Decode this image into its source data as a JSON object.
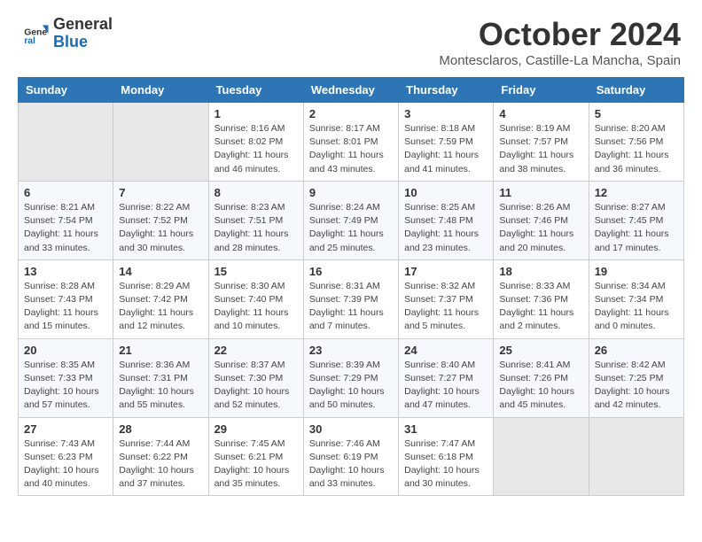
{
  "header": {
    "logo_general": "General",
    "logo_blue": "Blue",
    "month": "October 2024",
    "location": "Montesclaros, Castille-La Mancha, Spain"
  },
  "weekdays": [
    "Sunday",
    "Monday",
    "Tuesday",
    "Wednesday",
    "Thursday",
    "Friday",
    "Saturday"
  ],
  "weeks": [
    [
      {
        "day": "",
        "info": ""
      },
      {
        "day": "",
        "info": ""
      },
      {
        "day": "1",
        "info": "Sunrise: 8:16 AM\nSunset: 8:02 PM\nDaylight: 11 hours and 46 minutes."
      },
      {
        "day": "2",
        "info": "Sunrise: 8:17 AM\nSunset: 8:01 PM\nDaylight: 11 hours and 43 minutes."
      },
      {
        "day": "3",
        "info": "Sunrise: 8:18 AM\nSunset: 7:59 PM\nDaylight: 11 hours and 41 minutes."
      },
      {
        "day": "4",
        "info": "Sunrise: 8:19 AM\nSunset: 7:57 PM\nDaylight: 11 hours and 38 minutes."
      },
      {
        "day": "5",
        "info": "Sunrise: 8:20 AM\nSunset: 7:56 PM\nDaylight: 11 hours and 36 minutes."
      }
    ],
    [
      {
        "day": "6",
        "info": "Sunrise: 8:21 AM\nSunset: 7:54 PM\nDaylight: 11 hours and 33 minutes."
      },
      {
        "day": "7",
        "info": "Sunrise: 8:22 AM\nSunset: 7:52 PM\nDaylight: 11 hours and 30 minutes."
      },
      {
        "day": "8",
        "info": "Sunrise: 8:23 AM\nSunset: 7:51 PM\nDaylight: 11 hours and 28 minutes."
      },
      {
        "day": "9",
        "info": "Sunrise: 8:24 AM\nSunset: 7:49 PM\nDaylight: 11 hours and 25 minutes."
      },
      {
        "day": "10",
        "info": "Sunrise: 8:25 AM\nSunset: 7:48 PM\nDaylight: 11 hours and 23 minutes."
      },
      {
        "day": "11",
        "info": "Sunrise: 8:26 AM\nSunset: 7:46 PM\nDaylight: 11 hours and 20 minutes."
      },
      {
        "day": "12",
        "info": "Sunrise: 8:27 AM\nSunset: 7:45 PM\nDaylight: 11 hours and 17 minutes."
      }
    ],
    [
      {
        "day": "13",
        "info": "Sunrise: 8:28 AM\nSunset: 7:43 PM\nDaylight: 11 hours and 15 minutes."
      },
      {
        "day": "14",
        "info": "Sunrise: 8:29 AM\nSunset: 7:42 PM\nDaylight: 11 hours and 12 minutes."
      },
      {
        "day": "15",
        "info": "Sunrise: 8:30 AM\nSunset: 7:40 PM\nDaylight: 11 hours and 10 minutes."
      },
      {
        "day": "16",
        "info": "Sunrise: 8:31 AM\nSunset: 7:39 PM\nDaylight: 11 hours and 7 minutes."
      },
      {
        "day": "17",
        "info": "Sunrise: 8:32 AM\nSunset: 7:37 PM\nDaylight: 11 hours and 5 minutes."
      },
      {
        "day": "18",
        "info": "Sunrise: 8:33 AM\nSunset: 7:36 PM\nDaylight: 11 hours and 2 minutes."
      },
      {
        "day": "19",
        "info": "Sunrise: 8:34 AM\nSunset: 7:34 PM\nDaylight: 11 hours and 0 minutes."
      }
    ],
    [
      {
        "day": "20",
        "info": "Sunrise: 8:35 AM\nSunset: 7:33 PM\nDaylight: 10 hours and 57 minutes."
      },
      {
        "day": "21",
        "info": "Sunrise: 8:36 AM\nSunset: 7:31 PM\nDaylight: 10 hours and 55 minutes."
      },
      {
        "day": "22",
        "info": "Sunrise: 8:37 AM\nSunset: 7:30 PM\nDaylight: 10 hours and 52 minutes."
      },
      {
        "day": "23",
        "info": "Sunrise: 8:39 AM\nSunset: 7:29 PM\nDaylight: 10 hours and 50 minutes."
      },
      {
        "day": "24",
        "info": "Sunrise: 8:40 AM\nSunset: 7:27 PM\nDaylight: 10 hours and 47 minutes."
      },
      {
        "day": "25",
        "info": "Sunrise: 8:41 AM\nSunset: 7:26 PM\nDaylight: 10 hours and 45 minutes."
      },
      {
        "day": "26",
        "info": "Sunrise: 8:42 AM\nSunset: 7:25 PM\nDaylight: 10 hours and 42 minutes."
      }
    ],
    [
      {
        "day": "27",
        "info": "Sunrise: 7:43 AM\nSunset: 6:23 PM\nDaylight: 10 hours and 40 minutes."
      },
      {
        "day": "28",
        "info": "Sunrise: 7:44 AM\nSunset: 6:22 PM\nDaylight: 10 hours and 37 minutes."
      },
      {
        "day": "29",
        "info": "Sunrise: 7:45 AM\nSunset: 6:21 PM\nDaylight: 10 hours and 35 minutes."
      },
      {
        "day": "30",
        "info": "Sunrise: 7:46 AM\nSunset: 6:19 PM\nDaylight: 10 hours and 33 minutes."
      },
      {
        "day": "31",
        "info": "Sunrise: 7:47 AM\nSunset: 6:18 PM\nDaylight: 10 hours and 30 minutes."
      },
      {
        "day": "",
        "info": ""
      },
      {
        "day": "",
        "info": ""
      }
    ]
  ]
}
